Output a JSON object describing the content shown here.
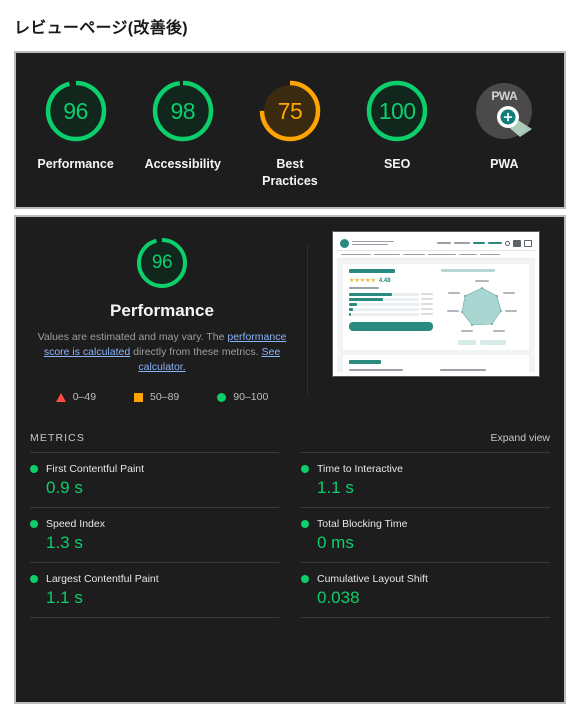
{
  "page": {
    "title": "レビューページ(改善後)"
  },
  "scores": [
    {
      "label": "Performance",
      "value": "96",
      "numeric": 96,
      "status": "pass",
      "color": "#0cce6b"
    },
    {
      "label": "Accessibility",
      "value": "98",
      "numeric": 98,
      "status": "pass",
      "color": "#0cce6b"
    },
    {
      "label": "Best\nPractices",
      "label_line1": "Best",
      "label_line2": "Practices",
      "value": "75",
      "numeric": 75,
      "status": "average",
      "color": "#ffa400"
    },
    {
      "label": "SEO",
      "value": "100",
      "numeric": 100,
      "status": "pass",
      "color": "#0cce6b"
    },
    {
      "label": "PWA",
      "value": "",
      "numeric": null,
      "status": "badge",
      "color": "#4a4a4a",
      "badge_text": "PWA"
    }
  ],
  "performance": {
    "gauge_value": "96",
    "gauge_numeric": 96,
    "heading": "Performance",
    "description_part1": "Values are estimated and may vary. The ",
    "link1": "performance score is calculated",
    "description_part2": " directly from these metrics. ",
    "link2": "See calculator.",
    "legend": [
      {
        "range": "0–49",
        "shape": "triangle",
        "color": "#ff4e42"
      },
      {
        "range": "50–89",
        "shape": "square",
        "color": "#ffa400"
      },
      {
        "range": "90–100",
        "shape": "circle",
        "color": "#0cce6b"
      }
    ]
  },
  "thumbnail": {
    "rating_value": "4.48",
    "stars": "★★★★★"
  },
  "metrics": {
    "section_title": "METRICS",
    "expand_label": "Expand view",
    "left_column": [
      {
        "label": "First Contentful Paint",
        "value": "0.9 s",
        "status": "pass"
      },
      {
        "label": "Speed Index",
        "value": "1.3 s",
        "status": "pass"
      },
      {
        "label": "Largest Contentful Paint",
        "value": "1.1 s",
        "status": "pass"
      }
    ],
    "right_column": [
      {
        "label": "Time to Interactive",
        "value": "1.1 s",
        "status": "pass"
      },
      {
        "label": "Total Blocking Time",
        "value": "0 ms",
        "status": "pass"
      },
      {
        "label": "Cumulative Layout Shift",
        "value": "0.038",
        "status": "pass"
      }
    ]
  }
}
